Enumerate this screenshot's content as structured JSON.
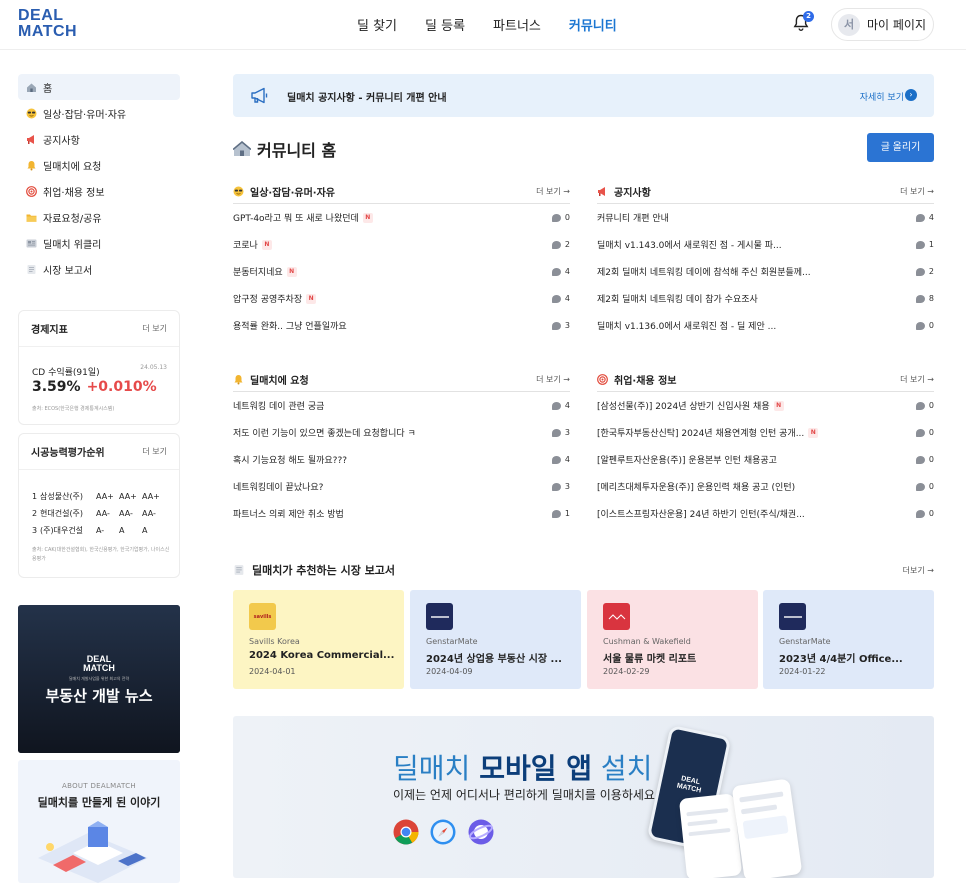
{
  "header": {
    "logo_line1": "DEAL",
    "logo_line2": "MATCH",
    "nav": [
      {
        "label": "딜 찾기"
      },
      {
        "label": "딜 등록"
      },
      {
        "label": "파트너스"
      },
      {
        "label": "커뮤니티"
      }
    ],
    "notification_count": "2",
    "avatar_initial": "서",
    "mypage_label": "마이 페이지"
  },
  "sidebar": {
    "items": [
      {
        "icon": "house-icon",
        "label": "홈"
      },
      {
        "icon": "sunglasses-face-icon",
        "label": "일상·잡담·유머·자유"
      },
      {
        "icon": "megaphone-icon",
        "label": "공지사항"
      },
      {
        "icon": "bell-icon",
        "label": "딜매치에 요청"
      },
      {
        "icon": "target-icon",
        "label": "취업·채용 정보"
      },
      {
        "icon": "folder-icon",
        "label": "자료요청/공유"
      },
      {
        "icon": "newspaper-icon",
        "label": "딜매치 위클리"
      },
      {
        "icon": "document-icon",
        "label": "시장 보고서"
      }
    ],
    "econ": {
      "title": "경제지표",
      "more": "더 보기",
      "label": "CD 수익률(91일)",
      "date": "24.05.13",
      "value": "3.59%",
      "change": "+0.010%",
      "source": "출처: ECOS(한국은행 경제통계시스템)"
    },
    "ranking": {
      "title": "시공능력평가순위",
      "more": "더 보기",
      "rows": [
        {
          "rank": "1",
          "company": "삼성물산(주)",
          "g1": "AA+",
          "g2": "AA+",
          "g3": "AA+"
        },
        {
          "rank": "2",
          "company": "현대건설(주)",
          "g1": "AA-",
          "g2": "AA-",
          "g3": "AA-"
        },
        {
          "rank": "3",
          "company": "(주)대우건설",
          "g1": "A-",
          "g2": "A",
          "g3": "A"
        }
      ],
      "source": "출처: CAK(대한건설협회), 한국신용평가, 한국기업평가, 나이스신용평가"
    },
    "banner1": {
      "logo_line1": "DEAL",
      "logo_line2": "MATCH",
      "sub": "딜매치 개발사업을 위한 최고의 전략",
      "title": "부동산 개발 뉴스"
    },
    "banner2": {
      "sub": "ABOUT DEALMATCH",
      "title": "딜매치를 만들게 된 이야기"
    }
  },
  "notice": {
    "text": "딜매치 공지사항 - 커뮤니티 개편 안내",
    "more": "자세히 보기"
  },
  "page_title": "커뮤니티 홈",
  "write_button": "글 올리기",
  "boards": [
    {
      "title": "일상·잡담·유머·자유",
      "icon": "sunglasses-face-icon",
      "more": "더 보기 →",
      "rows": [
        {
          "title": "GPT-4o라고 뭐 또 새로 나왔던데",
          "new": true,
          "count": "0"
        },
        {
          "title": "코로나",
          "new": true,
          "count": "2"
        },
        {
          "title": "분동터지네요",
          "new": true,
          "count": "4"
        },
        {
          "title": "압구정 공영주차장",
          "new": true,
          "count": "4"
        },
        {
          "title": "용적률 완화.. 그냥 언플일까요",
          "new": false,
          "count": "3"
        }
      ]
    },
    {
      "title": "공지사항",
      "icon": "megaphone-icon",
      "more": "더 보기 →",
      "rows": [
        {
          "title": "커뮤니티 개편 안내",
          "new": false,
          "count": "4"
        },
        {
          "title": "딜매치 v1.143.0에서 새로워진 점 - 게시물 파...",
          "new": false,
          "count": "1"
        },
        {
          "title": "제2회 딜매치 네트워킹 데이에 참석해 주신 회원분들께...",
          "new": false,
          "count": "2"
        },
        {
          "title": "제2회 딜매치 네트워킹 데이 참가 수요조사",
          "new": false,
          "count": "8"
        },
        {
          "title": "딜매치 v1.136.0에서 새로워진 점 - 딜 제안 ...",
          "new": false,
          "count": "0"
        }
      ]
    },
    {
      "title": "딜매치에 요청",
      "icon": "bell-icon",
      "more": "더 보기 →",
      "rows": [
        {
          "title": "네트워킹 데이 관련 궁금",
          "new": false,
          "count": "4"
        },
        {
          "title": "저도 이런 기능이 있으면 좋겠는데 요청합니다 ㅋ",
          "new": false,
          "count": "3"
        },
        {
          "title": "혹시 기능요청 해도 될까요???",
          "new": false,
          "count": "4"
        },
        {
          "title": "네트워킹데이 끝났나요?",
          "new": false,
          "count": "3"
        },
        {
          "title": "파트너스 의뢰 제안 취소 방법",
          "new": false,
          "count": "1"
        }
      ]
    },
    {
      "title": "취업·채용 정보",
      "icon": "target-icon",
      "more": "더 보기 →",
      "rows": [
        {
          "title": "[삼성선물(주)] 2024년 상반기 신입사원 채용",
          "new": true,
          "count": "0"
        },
        {
          "title": "[한국투자부동산신탁] 2024년 채용연계형 인턴 공개...",
          "new": true,
          "count": "0"
        },
        {
          "title": "[알펜루트자산운용(주)] 운용본부 인턴 채용공고",
          "new": false,
          "count": "0"
        },
        {
          "title": "[메리츠대체투자운용(주)] 운용인력 채용 공고 (인턴)",
          "new": false,
          "count": "0"
        },
        {
          "title": "[이스트스프링자산운용] 24년 하반기 인턴(주식/채권...",
          "new": false,
          "count": "0"
        }
      ]
    }
  ],
  "reports": {
    "title": "딜매치가 추천하는 시장 보고서",
    "more": "더보기 →",
    "cards": [
      {
        "source": "Savills Korea",
        "title": "2024 Korea Commercial...",
        "date": "2024-04-01",
        "bg": "#fdf5c3",
        "logo_bg": "#f2c94c",
        "logo_text": "savills"
      },
      {
        "source": "GenstarMate",
        "title": "2024년 상업용 부동산 시장 ...",
        "date": "2024-04-09",
        "bg": "#dfe9f9",
        "logo_bg": "#1f2a5c",
        "logo_text": ""
      },
      {
        "source": "Cushman & Wakefield",
        "title": "서울 물류 마켓 리포트",
        "date": "2024-02-29",
        "bg": "#fbe1e4",
        "logo_bg": "#d9343f",
        "logo_text": ""
      },
      {
        "source": "GenstarMate",
        "title": "2023년 4/4분기 Office...",
        "date": "2024-01-22",
        "bg": "#dfe9f9",
        "logo_bg": "#1f2a5c",
        "logo_text": ""
      }
    ]
  },
  "app_banner": {
    "title_pre": "딜매치 ",
    "title_bold": "모바일 앱",
    "title_post": " 설치",
    "sub": "이제는 언제 어디서나 편리하게 딜매치를 이용하세요",
    "browsers": [
      "chrome-icon",
      "safari-icon",
      "samsung-internet-icon"
    ]
  },
  "colors": {
    "accent": "#1b76d2",
    "button": "#2b74d3",
    "change_up": "#e64a4a"
  }
}
